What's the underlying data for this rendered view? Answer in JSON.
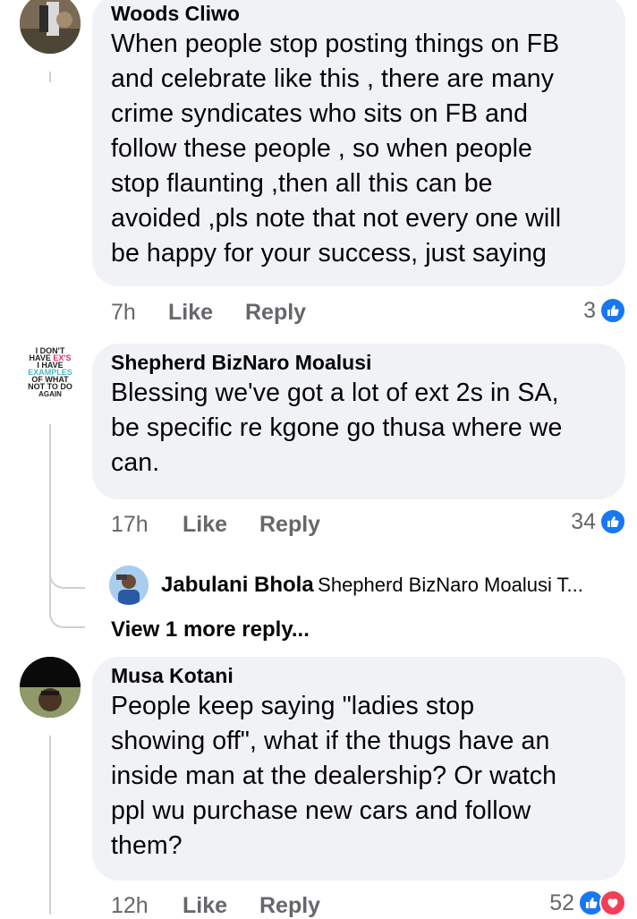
{
  "comments": [
    {
      "author": "Woods Cliwo",
      "lines": [
        "When people stop posting things on FB",
        "and celebrate like this , there are many",
        "crime syndicates who sits on FB and",
        "follow these people , so when people",
        "stop flaunting ,then all this can be",
        "avoided ,pls note that not every one will",
        "be happy for your success, just saying"
      ],
      "time": "7h",
      "like_label": "Like",
      "reply_label": "Reply",
      "reaction_count": "3",
      "reactions": [
        "like-icon"
      ]
    },
    {
      "author": "Shepherd BizNaro Moalusi",
      "avatar_text": [
        "I DON'T",
        "HAVE EX'S",
        "I HAVE",
        "EXAMPLES",
        "OF WHAT",
        "NOT TO DO",
        "AGAIN"
      ],
      "lines": [
        "Blessing we've got a lot of ext 2s in SA,",
        "be specific re kgone go thusa where we",
        "can."
      ],
      "time": "17h",
      "like_label": "Like",
      "reply_label": "Reply",
      "reaction_count": "34",
      "reactions": [
        "like-icon"
      ]
    },
    {
      "author": "Musa Kotani",
      "lines": [
        "People keep saying \"ladies stop",
        "showing off\", what if the thugs have an",
        "inside man at the dealership? Or watch",
        "ppl wu purchase new cars and follow",
        "them?"
      ],
      "time": "12h",
      "like_label": "Like",
      "reply_label": "Reply",
      "reaction_count": "52",
      "reactions": [
        "like-icon",
        "love-icon"
      ]
    }
  ],
  "reply_preview": {
    "author": "Jabulani Bhola",
    "text": "Shepherd BizNaro Moalusi T..."
  },
  "view_more_label": "View 1 more reply...",
  "colors": {
    "bubble": "#f0f2f5",
    "meta": "#65676b",
    "like": "#1877f2",
    "love": "#f33e58",
    "thread": "#ced0d4"
  }
}
